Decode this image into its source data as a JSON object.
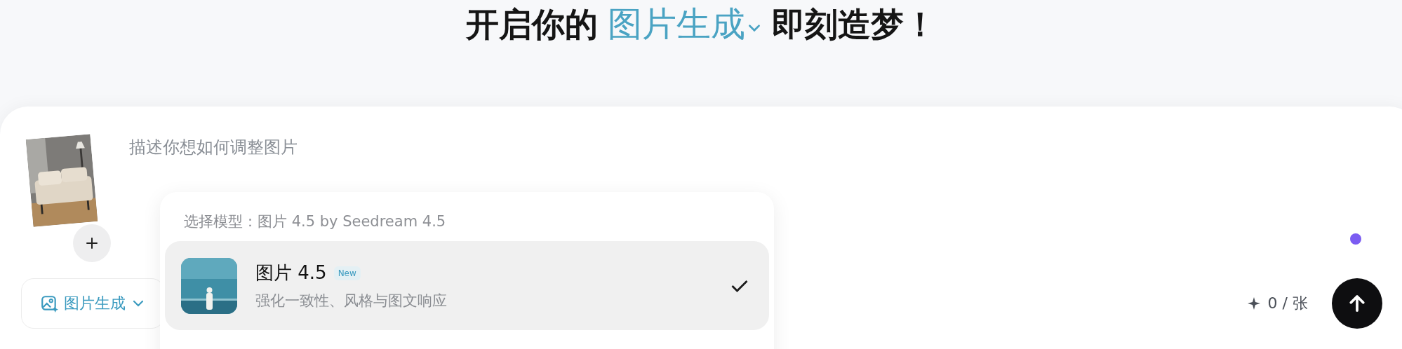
{
  "headline": {
    "prefix": "开启你的",
    "mode": "图片生成",
    "mode_expanded": false,
    "suffix": "即刻造梦！"
  },
  "prompt": {
    "placeholder": "描述你想如何调整图片"
  },
  "mode_button": {
    "label": "图片生成"
  },
  "model_menu": {
    "header": "选择模型：图片 4.5 by Seedream 4.5",
    "options": [
      {
        "name": "图片 4.5",
        "badge": "New",
        "description": "强化一致性、风格与图文响应",
        "selected": true
      }
    ]
  },
  "credits": "0 / 张"
}
